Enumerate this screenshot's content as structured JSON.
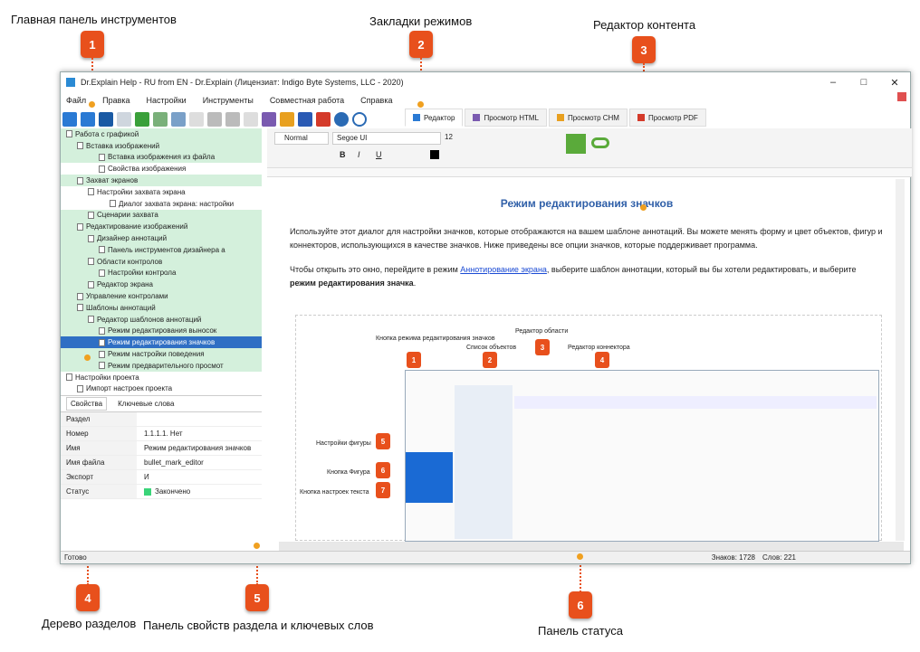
{
  "callouts": {
    "c1": {
      "num": "1",
      "label": "Главная панель инструментов"
    },
    "c2": {
      "num": "2",
      "label": "Закладки режимов"
    },
    "c3": {
      "num": "3",
      "label": "Редактор контента"
    },
    "c4": {
      "num": "4",
      "label": "Дерево разделов"
    },
    "c5": {
      "num": "5",
      "label": "Панель свойств раздела и ключевых слов"
    },
    "c6": {
      "num": "6",
      "label": "Панель статуса"
    }
  },
  "window": {
    "title": "Dr.Explain Help - RU from EN - Dr.Explain (Лицензиат: Indigo Byte Systems, LLC - 2020)",
    "menu": [
      "Файл",
      "Правка",
      "Настройки",
      "Инструменты",
      "Совместная работа",
      "Справка"
    ],
    "tabs": [
      "Редактор",
      "Просмотр HTML",
      "Просмотр CHM",
      "Просмотр PDF"
    ]
  },
  "tree": [
    {
      "t": "Работа с графикой",
      "green": true,
      "indent": 0,
      "sel": false
    },
    {
      "t": "Вставка изображений",
      "green": true,
      "indent": 1,
      "sel": false
    },
    {
      "t": "Вставка изображения из файла",
      "green": true,
      "indent": 3,
      "sel": false
    },
    {
      "t": "Свойства изображения",
      "green": false,
      "indent": 3,
      "sel": false
    },
    {
      "t": "Захват экранов",
      "green": true,
      "indent": 1,
      "sel": false
    },
    {
      "t": "Настройки захвата экрана",
      "green": false,
      "indent": 2,
      "sel": false
    },
    {
      "t": "Диалог захвата экрана: настройки",
      "green": false,
      "indent": 4,
      "sel": false
    },
    {
      "t": "Сценарии захвата",
      "green": true,
      "indent": 2,
      "sel": false
    },
    {
      "t": "Редактирование изображений",
      "green": true,
      "indent": 1,
      "sel": false
    },
    {
      "t": "Дизайнер аннотаций",
      "green": true,
      "indent": 2,
      "sel": false
    },
    {
      "t": "Панель инструментов дизайнера а",
      "green": true,
      "indent": 3,
      "sel": false
    },
    {
      "t": "Области контролов",
      "green": true,
      "indent": 2,
      "sel": false
    },
    {
      "t": "Настройки контрола",
      "green": true,
      "indent": 3,
      "sel": false
    },
    {
      "t": "Редактор экрана",
      "green": true,
      "indent": 2,
      "sel": false
    },
    {
      "t": "Управление контролами",
      "green": true,
      "indent": 1,
      "sel": false
    },
    {
      "t": "Шаблоны аннотаций",
      "green": true,
      "indent": 1,
      "sel": false
    },
    {
      "t": "Редактор шаблонов аннотаций",
      "green": true,
      "indent": 2,
      "sel": false
    },
    {
      "t": "Режим редактирования выносок",
      "green": true,
      "indent": 3,
      "sel": false
    },
    {
      "t": "Режим редактирования значков",
      "green": false,
      "indent": 3,
      "sel": true
    },
    {
      "t": "Режим настройки поведения",
      "green": true,
      "indent": 3,
      "sel": false
    },
    {
      "t": "Режим предварительного просмот",
      "green": true,
      "indent": 3,
      "sel": false
    },
    {
      "t": "Настройки проекта",
      "green": false,
      "indent": 0,
      "sel": false
    },
    {
      "t": "Импорт настроек проекта",
      "green": false,
      "indent": 1,
      "sel": false
    }
  ],
  "props": {
    "tab_props": "Свойства",
    "tab_keywords": "Ключевые слова",
    "section": "Раздел",
    "rows": [
      {
        "k": "Номер",
        "v": "1.1.1.1.    Нет"
      },
      {
        "k": "Имя",
        "v": "Режим редактирования значков"
      },
      {
        "k": "Имя файла",
        "v": "bullet_mark_editor"
      },
      {
        "k": "Экспорт",
        "v": "И"
      },
      {
        "k": "Статус",
        "v": "Закончено"
      }
    ]
  },
  "format": {
    "style": "Normal",
    "font": "Segoe UI",
    "size": "12"
  },
  "editor": {
    "heading": "Режим редактирования значков",
    "p1": "Используйте этот диалог для настройки значков, которые отображаются на вашем шаблоне аннотаций. Вы можете менять форму и цвет объектов, фигур и коннекторов, использующихся в качестве значков. Ниже приведены все опции значков, которые поддерживает программа.",
    "p2_a": "Чтобы открыть это окно, перейдите в режим ",
    "p2_link": "Аннотирование экрана",
    "p2_b": ", выберите шаблон аннотации, который вы бы хотели редактировать, и выберите ",
    "p2_bold": "режим редактирования значка",
    "p2_c": "."
  },
  "inner": {
    "labels": [
      {
        "n": "1",
        "t": "Кнопка режима\nредактирования значков"
      },
      {
        "n": "2",
        "t": "Список объектов"
      },
      {
        "n": "3",
        "t": "Редактор области"
      },
      {
        "n": "4",
        "t": "Редактор коннектора"
      },
      {
        "n": "5",
        "t": "Настройки фигуры"
      },
      {
        "n": "6",
        "t": "Кнопка Фигура"
      },
      {
        "n": "7",
        "t": "Кнопка настроек текста"
      }
    ]
  },
  "status": {
    "ready": "Готово",
    "chars": "Знаков: 1728",
    "words": "Слов: 221"
  },
  "colors": {
    "accent": "#e8501c",
    "tree_green": "#d4f0dc",
    "selection": "#2f6fc4",
    "heading": "#2f5fa8"
  }
}
